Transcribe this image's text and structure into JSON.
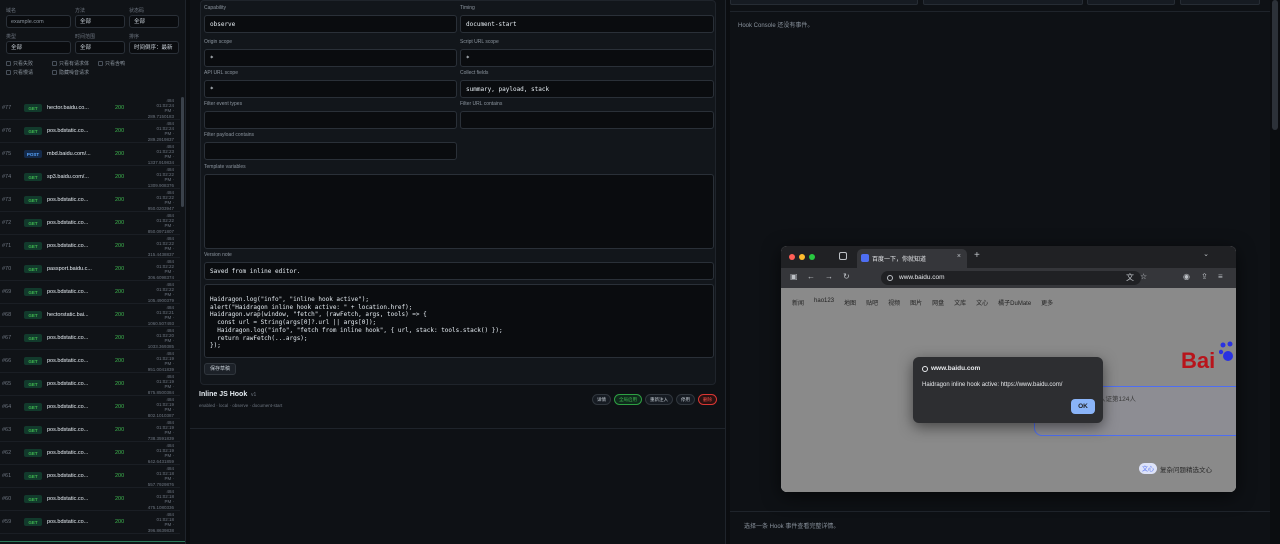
{
  "filters": {
    "domain_label": "域名",
    "domain_placeholder": "example.com",
    "method_label": "方法",
    "method_value": "全部",
    "status_label": "状态码",
    "status_value": "全部",
    "type_label": "类型",
    "type_value": "全部",
    "time_label": "时间范围",
    "time_value": "全部",
    "sort_label": "排序",
    "sort_value": "时间倒序：最新",
    "checks": [
      "只看失败",
      "只看有请求体",
      "只看含鸭",
      "只看慢请",
      "隐藏噪音请求"
    ]
  },
  "requests": [
    {
      "id": "#77",
      "method": "GET",
      "host": "hector.baidu.co...",
      "status": "200",
      "m1": "484",
      "m2": "01:02:24",
      "m3": "PM ·",
      "m4": "289.7150183"
    },
    {
      "id": "#76",
      "method": "GET",
      "host": "pos.bdstatic.co...",
      "status": "200",
      "m1": "484",
      "m2": "01:02:24",
      "m3": "PM ·",
      "m4": "289.2919837"
    },
    {
      "id": "#75",
      "method": "POST",
      "host": "mbd.baidu.com/...",
      "status": "200",
      "m1": "484",
      "m2": "01:02:23",
      "m3": "PM ·",
      "m4": "1337.919834"
    },
    {
      "id": "#74",
      "method": "GET",
      "host": "sp3.baidu.com/...",
      "status": "200",
      "m1": "484",
      "m2": "01:02:22",
      "m3": "PM ·",
      "m4": "1309.908376"
    },
    {
      "id": "#73",
      "method": "GET",
      "host": "pos.bdstatic.co...",
      "status": "200",
      "m1": "484",
      "m2": "01:02:22",
      "m3": "PM ·",
      "m4": "950.0203947"
    },
    {
      "id": "#72",
      "method": "GET",
      "host": "pos.bdstatic.co...",
      "status": "200",
      "m1": "484",
      "m2": "01:02:22",
      "m3": "PM ·",
      "m4": "850.0971807"
    },
    {
      "id": "#71",
      "method": "GET",
      "host": "pos.bdstatic.co...",
      "status": "200",
      "m1": "484",
      "m2": "01:02:22",
      "m3": "PM ·",
      "m4": "315.4438837"
    },
    {
      "id": "#70",
      "method": "GET",
      "host": "passport.baidu.c...",
      "status": "200",
      "m1": "484",
      "m2": "01:02:22",
      "m3": "PM ·",
      "m4": "306.6098374"
    },
    {
      "id": "#69",
      "method": "GET",
      "host": "pos.bdstatic.co...",
      "status": "200",
      "m1": "484",
      "m2": "01:02:22",
      "m3": "PM ·",
      "m4": "105.4900379"
    },
    {
      "id": "#68",
      "method": "GET",
      "host": "hectorstatic.bai...",
      "status": "200",
      "m1": "484",
      "m2": "01:02:21",
      "m3": "PM ·",
      "m4": "1060.507493"
    },
    {
      "id": "#67",
      "method": "GET",
      "host": "pos.bdstatic.co...",
      "status": "200",
      "m1": "484",
      "m2": "01:02:20",
      "m3": "PM ·",
      "m4": "1033.369385"
    },
    {
      "id": "#66",
      "method": "GET",
      "host": "pos.bdstatic.co...",
      "status": "200",
      "m1": "484",
      "m2": "01:02:19",
      "m3": "PM ·",
      "m4": "951.0041839"
    },
    {
      "id": "#65",
      "method": "GET",
      "host": "pos.bdstatic.co...",
      "status": "200",
      "m1": "484",
      "m2": "01:02:19",
      "m3": "PM ·",
      "m4": "875.8500384"
    },
    {
      "id": "#64",
      "method": "GET",
      "host": "pos.bdstatic.co...",
      "status": "200",
      "m1": "484",
      "m2": "01:02:19",
      "m3": "PM ·",
      "m4": "802.1010387"
    },
    {
      "id": "#63",
      "method": "GET",
      "host": "pos.bdstatic.co...",
      "status": "200",
      "m1": "484",
      "m2": "01:02:19",
      "m3": "PM ·",
      "m4": "738.3591839"
    },
    {
      "id": "#62",
      "method": "GET",
      "host": "pos.bdstatic.co...",
      "status": "200",
      "m1": "484",
      "m2": "01:02:19",
      "m3": "PM ·",
      "m4": "642.6431859"
    },
    {
      "id": "#61",
      "method": "GET",
      "host": "pos.bdstatic.co...",
      "status": "200",
      "m1": "484",
      "m2": "01:02:18",
      "m3": "PM ·",
      "m4": "557.7929876"
    },
    {
      "id": "#60",
      "method": "GET",
      "host": "pos.bdstatic.co...",
      "status": "200",
      "m1": "484",
      "m2": "01:02:18",
      "m3": "PM ·",
      "m4": "475.1080336"
    },
    {
      "id": "#59",
      "method": "GET",
      "host": "pos.bdstatic.co...",
      "status": "200",
      "m1": "484",
      "m2": "01:02:18",
      "m3": "PM ·",
      "m4": "396.8639838"
    }
  ],
  "editor": {
    "capability_label": "Capability",
    "capability_value": "observe",
    "timing_label": "Timing",
    "timing_value": "document-start",
    "origin_label": "Origin scope",
    "origin_value": "*",
    "script_label": "Script URL scope",
    "script_value": "*",
    "api_label": "API URL scope",
    "api_value": "*",
    "collect_label": "Collect fields",
    "collect_value": "summary, payload, stack",
    "filter_event_label": "Filter event types",
    "filter_url_label": "Filter URL contains",
    "filter_payload_label": "Filter payload contains",
    "template_label": "Template variables",
    "version_label": "Version note",
    "version_value": "Saved from inline editor.",
    "code": "Haidragon.log(\"info\", \"inline hook active\");\nalert(\"Haidragon inline hook active: \" + location.href);\nHaidragon.wrap(window, \"fetch\", (rawFetch, args, tools) => {\n  const url = String(args[0]?.url || args[0]);\n  Haidragon.log(\"info\", \"fetch from inline hook\", { url, stack: tools.stack() });\n  return rawFetch(...args);\n});",
    "save_label": "保存草稿"
  },
  "hook": {
    "title": "Inline JS Hook",
    "version": "v1",
    "subtitle": "enabled · local · observe · document-start",
    "buttons": [
      "详情",
      "全局启用",
      "重新注入",
      "停用",
      "删除"
    ]
  },
  "console": {
    "empty": "Hook Console 还没有事件。",
    "hint": "选择一条 Hook 事件查看完整详情。"
  },
  "browser": {
    "tab_title": "百度一下，你就知道",
    "url": "www.baidu.com",
    "nav_links": [
      "新闻",
      "hao123",
      "地图",
      "贴吧",
      "视频",
      "图片",
      "网盘",
      "文库",
      "文心",
      "橘子DuMate",
      "更多"
    ],
    "logo": "Bai",
    "search_hint": "人证第124人",
    "ai_badge": "文心",
    "ai_text": "复杂问题精选文心"
  },
  "dialog": {
    "title": "www.baidu.com",
    "message": "Haidragon inline hook active: https://www.baidu.com/",
    "ok": "OK"
  }
}
